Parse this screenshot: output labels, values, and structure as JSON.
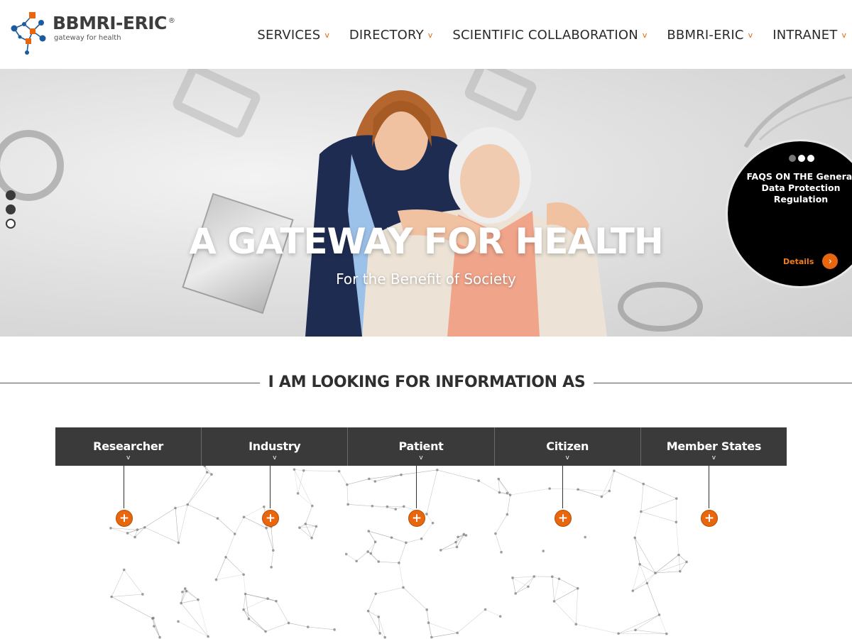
{
  "brand": {
    "name": "BBMRI-ERIC",
    "registered": "®",
    "tagline": "gateway for health",
    "colors": {
      "orange": "#e8660e",
      "blue": "#1e5a9e",
      "dark": "#3a3a3a"
    }
  },
  "nav": {
    "items": [
      {
        "label": "SERVICES",
        "caret": "v"
      },
      {
        "label": "DIRECTORY",
        "caret": "v"
      },
      {
        "label": "SCIENTIFIC COLLABORATION",
        "caret": "v"
      },
      {
        "label": "BBMRI-ERIC",
        "caret": "v"
      },
      {
        "label": "INTRANET",
        "caret": "v"
      }
    ]
  },
  "hero": {
    "title": "A GATEWAY FOR HEALTH",
    "subtitle": "For the Benefit of Society",
    "slides": {
      "count": 3,
      "active": [
        0,
        1
      ]
    }
  },
  "faq": {
    "title": "FAQS ON THE General Data Protection Regulation",
    "details_label": "Details",
    "arrow": "›"
  },
  "section": {
    "heading": "I AM LOOKING FOR INFORMATION AS"
  },
  "audience": {
    "tabs": [
      {
        "label": "Researcher",
        "caret": "v",
        "plus": "+"
      },
      {
        "label": "Industry",
        "caret": "v",
        "plus": "+"
      },
      {
        "label": "Patient",
        "caret": "v",
        "plus": "+"
      },
      {
        "label": "Citizen",
        "caret": "v",
        "plus": "+"
      },
      {
        "label": "Member States",
        "caret": "v",
        "plus": "+"
      }
    ]
  }
}
